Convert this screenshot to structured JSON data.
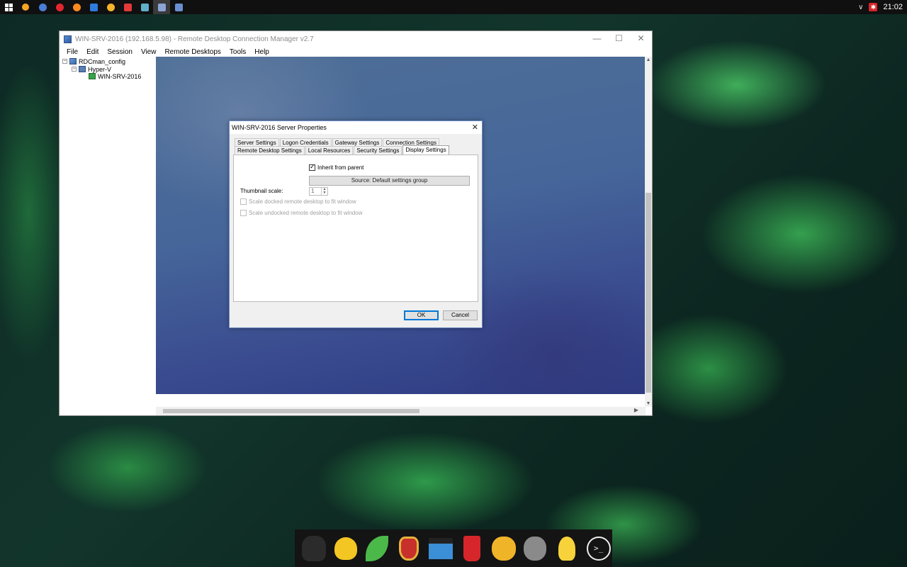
{
  "desktop": {
    "taskbar": {
      "clock": "21:02",
      "pinned_icons": [
        {
          "name": "start-icon"
        },
        {
          "name": "search-icon",
          "color": "#f5a623"
        },
        {
          "name": "chrome-dev-icon",
          "color": "#4a7dd6"
        },
        {
          "name": "opera-icon",
          "color": "#e3262f"
        },
        {
          "name": "firefox-icon",
          "color": "#ff8a1f"
        },
        {
          "name": "app-w-icon",
          "color": "#2f7be0"
        },
        {
          "name": "circle-app-icon",
          "color": "#f4b52b"
        },
        {
          "name": "vivaldi-icon",
          "color": "#e23a3a"
        },
        {
          "name": "sticky-app-icon",
          "color": "#5fb0c9"
        },
        {
          "name": "rdcman-taskbar-icon",
          "color": "#8ba4d4"
        },
        {
          "name": "notes-app-icon",
          "color": "#6a8fd0"
        }
      ]
    },
    "dock_icons": [
      "gorilla-icon",
      "duck-icon",
      "leaf-icon",
      "iron-man-icon",
      "movie-clapper-icon",
      "soda-cup-icon",
      "winnie-pooh-icon",
      "monkey-icon",
      "lightbulb-icon",
      "terminal-icon"
    ]
  },
  "rdcman": {
    "title": "WIN-SRV-2016 (192.168.5.98) - Remote Desktop Connection Manager v2.7",
    "menu": [
      "File",
      "Edit",
      "Session",
      "View",
      "Remote Desktops",
      "Tools",
      "Help"
    ],
    "tree": {
      "root": "RDCman_config",
      "group": "Hyper-V",
      "server": "WIN-SRV-2016"
    }
  },
  "dialog": {
    "title": "WIN-SRV-2016 Server Properties",
    "tabs_row1": [
      "Server Settings",
      "Logon Credentials",
      "Gateway Settings",
      "Connection Settings"
    ],
    "tabs_row2": [
      "Remote Desktop Settings",
      "Local Resources",
      "Security Settings",
      "Display Settings"
    ],
    "active_tab": "Display Settings",
    "inherit_label": "Inherit from parent",
    "inherit_checked": true,
    "source_button": "Source: Default settings group",
    "thumbnail_label": "Thumbnail scale:",
    "thumbnail_value": "1",
    "scale_docked": "Scale docked remote desktop to fit window",
    "scale_undocked": "Scale undocked remote desktop to fit window",
    "ok": "OK",
    "cancel": "Cancel"
  }
}
